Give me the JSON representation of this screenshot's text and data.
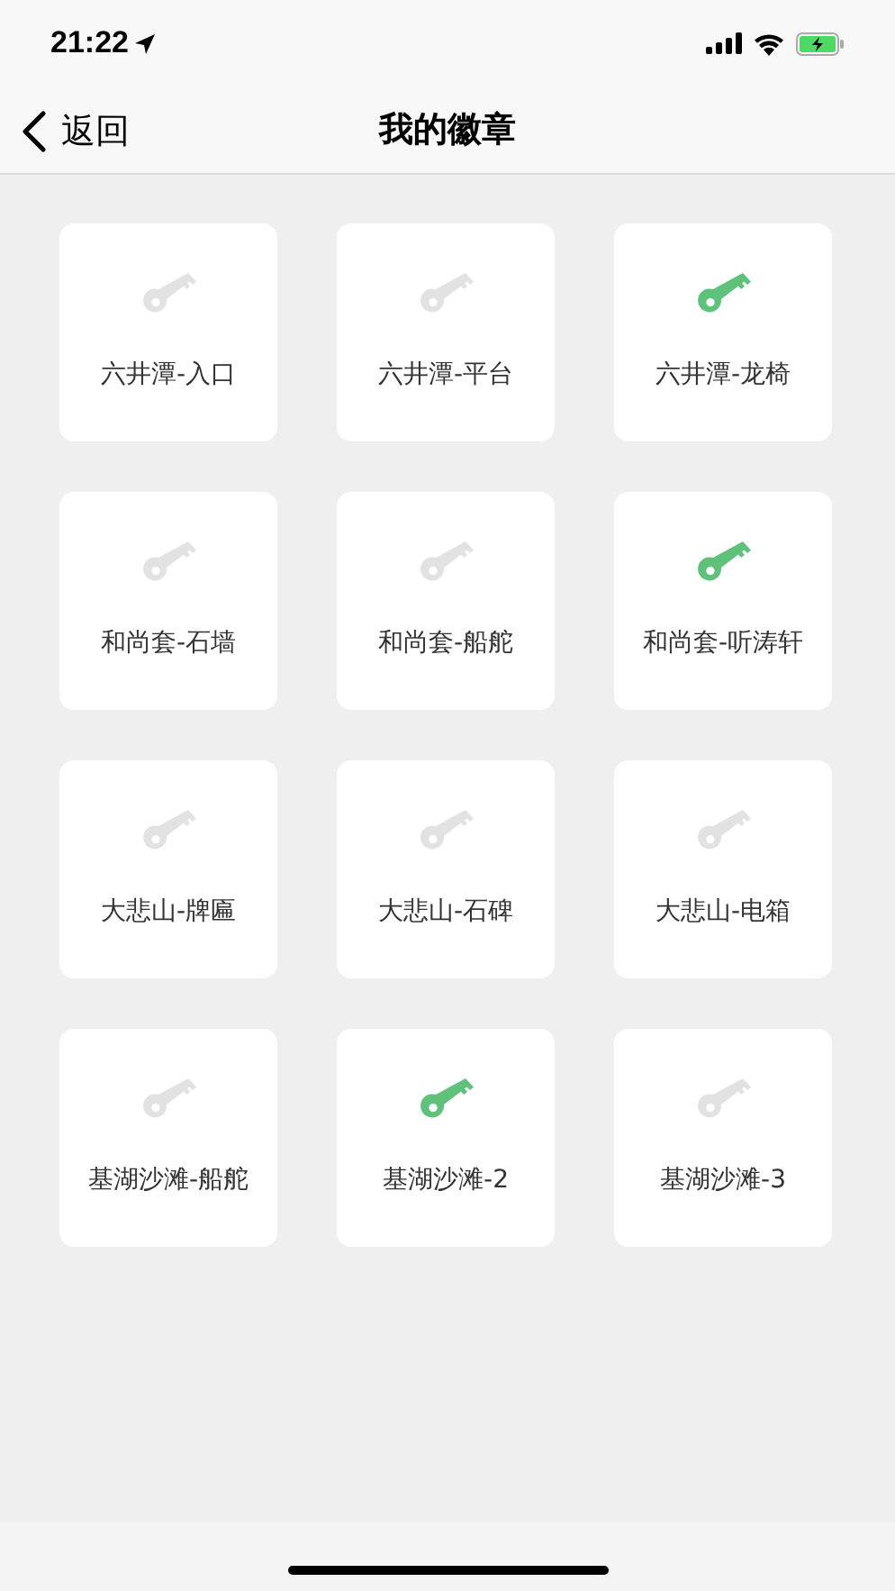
{
  "status_bar": {
    "time": "21:22"
  },
  "nav": {
    "back": "返回",
    "title": "我的徽章"
  },
  "badges": [
    {
      "label": "六井潭-入口",
      "earned": false
    },
    {
      "label": "六井潭-平台",
      "earned": false
    },
    {
      "label": "六井潭-龙椅",
      "earned": true
    },
    {
      "label": "和尚套-石墙",
      "earned": false
    },
    {
      "label": "和尚套-船舵",
      "earned": false
    },
    {
      "label": "和尚套-听涛轩",
      "earned": true
    },
    {
      "label": "大悲山-牌匾",
      "earned": false
    },
    {
      "label": "大悲山-石碑",
      "earned": false
    },
    {
      "label": "大悲山-电箱",
      "earned": false
    },
    {
      "label": "基湖沙滩-船舵",
      "earned": false
    },
    {
      "label": "基湖沙滩-2",
      "earned": true
    },
    {
      "label": "基湖沙滩-3",
      "earned": false
    }
  ]
}
